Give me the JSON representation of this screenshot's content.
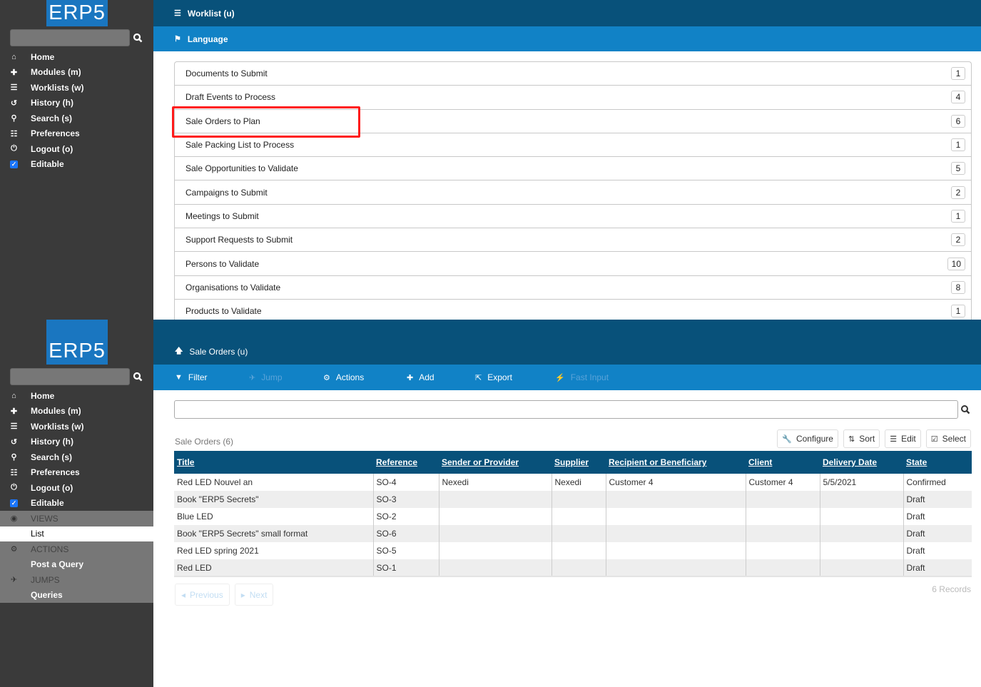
{
  "brand": {
    "logo_text": "ERP5",
    "colors": {
      "header_dark": "#08517a",
      "header_light": "#1182c6",
      "sidebar": "#3a3a3a",
      "highlight": "#ff1a1a"
    }
  },
  "sidebar": {
    "search_placeholder": "",
    "items": [
      {
        "icon": "home-icon",
        "label": "Home"
      },
      {
        "icon": "puzzle-icon",
        "label": "Modules (m)"
      },
      {
        "icon": "worklist-icon",
        "label": "Worklists (w)"
      },
      {
        "icon": "history-icon",
        "label": "History (h)"
      },
      {
        "icon": "search-icon",
        "label": "Search (s)"
      },
      {
        "icon": "sliders-icon",
        "label": "Preferences"
      },
      {
        "icon": "power-icon",
        "label": "Logout (o)"
      },
      {
        "icon": "checkbox-icon",
        "label": "Editable",
        "checked": true
      }
    ],
    "panels": {
      "views": {
        "header": "VIEWS",
        "links": [
          "List"
        ],
        "active": "List"
      },
      "actions": {
        "header": "ACTIONS",
        "links": [
          "Post a Query"
        ]
      },
      "jumps": {
        "header": "JUMPS",
        "links": [
          "Queries"
        ]
      }
    }
  },
  "top_screen": {
    "header": {
      "title": "Worklist (u)",
      "subheader": "Language"
    },
    "worklist": [
      {
        "label": "Documents to Submit",
        "count": "1"
      },
      {
        "label": "Draft Events to Process",
        "count": "4"
      },
      {
        "label": "Sale Orders to Plan",
        "count": "6",
        "highlighted": true
      },
      {
        "label": "Sale Packing List to Process",
        "count": "1"
      },
      {
        "label": "Sale Opportunities to Validate",
        "count": "5"
      },
      {
        "label": "Campaigns to Submit",
        "count": "2"
      },
      {
        "label": "Meetings to Submit",
        "count": "1"
      },
      {
        "label": "Support Requests to Submit",
        "count": "2"
      },
      {
        "label": "Persons to Validate",
        "count": "10"
      },
      {
        "label": "Organisations to Validate",
        "count": "8"
      },
      {
        "label": "Products to Validate",
        "count": "1"
      }
    ]
  },
  "bottom_screen": {
    "header": {
      "title": "Sale Orders (u)"
    },
    "toolbar": [
      {
        "icon": "filter-icon",
        "glyph": "▼",
        "label": "Filter",
        "enabled": true
      },
      {
        "icon": "jump-icon",
        "glyph": "✈",
        "label": "Jump",
        "enabled": false
      },
      {
        "icon": "gears-icon",
        "glyph": "⚙",
        "label": "Actions",
        "enabled": true
      },
      {
        "icon": "plus-icon",
        "glyph": "✚",
        "label": "Add",
        "enabled": true
      },
      {
        "icon": "export-icon",
        "glyph": "⇱",
        "label": "Export",
        "enabled": true
      },
      {
        "icon": "magic-wand-icon",
        "glyph": "⚡",
        "label": "Fast Input",
        "enabled": false
      }
    ],
    "search": {
      "value": "",
      "placeholder": ""
    },
    "list_title": "Sale Orders (6)",
    "list_buttons": [
      {
        "icon": "wrench-icon",
        "glyph": "🔧",
        "label": "Configure"
      },
      {
        "icon": "sort-icon",
        "glyph": "⇅",
        "label": "Sort"
      },
      {
        "icon": "list-icon",
        "glyph": "☰",
        "label": "Edit"
      },
      {
        "icon": "check-square-icon",
        "glyph": "☑",
        "label": "Select"
      }
    ],
    "table": {
      "columns": [
        "Title",
        "Reference",
        "Sender or Provider",
        "Supplier",
        "Recipient or Beneficiary",
        "Client",
        "Delivery Date",
        "State"
      ],
      "rows": [
        [
          "Red LED Nouvel an",
          "SO-4",
          "Nexedi",
          "Nexedi",
          "Customer 4",
          "Customer 4",
          "5/5/2021",
          "Confirmed"
        ],
        [
          "Book \"ERP5 Secrets\"",
          "SO-3",
          "",
          "",
          "",
          "",
          "",
          "Draft"
        ],
        [
          "Blue LED",
          "SO-2",
          "",
          "",
          "",
          "",
          "",
          "Draft"
        ],
        [
          "Book \"ERP5 Secrets\" small format",
          "SO-6",
          "",
          "",
          "",
          "",
          "",
          "Draft"
        ],
        [
          "Red LED spring 2021",
          "SO-5",
          "",
          "",
          "",
          "",
          "",
          "Draft"
        ],
        [
          "Red LED",
          "SO-1",
          "",
          "",
          "",
          "",
          "",
          "Draft"
        ]
      ]
    },
    "pagination": {
      "previous": "Previous",
      "next": "Next",
      "records": "6 Records"
    }
  }
}
